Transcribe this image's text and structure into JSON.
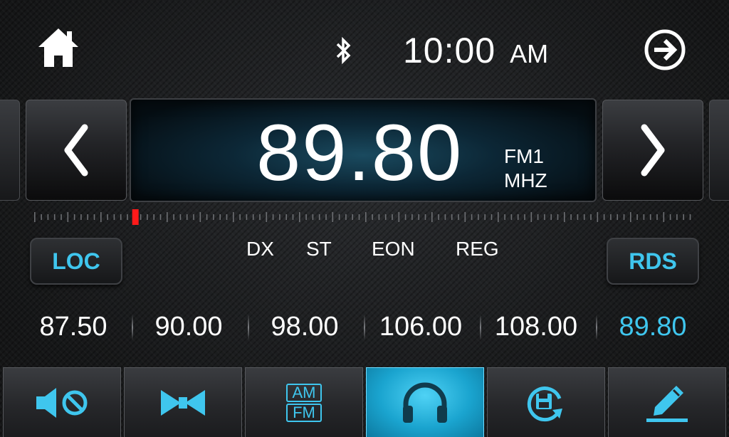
{
  "header": {
    "home_icon": "home-icon",
    "bluetooth_icon": "bluetooth-icon",
    "time": "10:00",
    "ampm": "AM",
    "next_icon": "arrow-right-circle-icon"
  },
  "tuner": {
    "frequency": "89.80",
    "band": "FM1",
    "unit": "MHZ",
    "scale_position": 0.15
  },
  "flags": {
    "loc": "LOC",
    "dx": "DX",
    "st": "ST",
    "eon": "EON",
    "reg": "REG",
    "rds": "RDS"
  },
  "presets": [
    "87.50",
    "90.00",
    "98.00",
    "106.00",
    "108.00",
    "89.80"
  ],
  "active_preset_index": 5,
  "toolbar": {
    "items": [
      {
        "icon": "mute-icon"
      },
      {
        "icon": "stereo-mono-icon"
      },
      {
        "icon": "am-fm-icon",
        "am": "AM",
        "fm": "FM"
      },
      {
        "icon": "headphones-icon"
      },
      {
        "icon": "save-refresh-icon"
      },
      {
        "icon": "edit-pen-icon"
      }
    ],
    "active_index": 3
  },
  "colors": {
    "accent": "#3fc6ee",
    "marker": "#ff1a1a",
    "text": "#ffffff"
  }
}
